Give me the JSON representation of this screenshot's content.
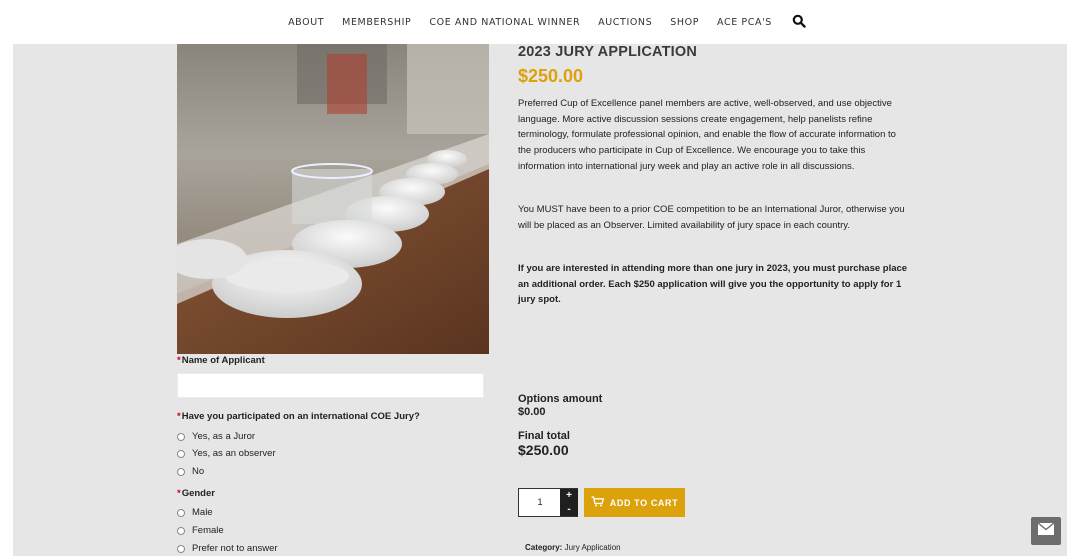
{
  "nav": {
    "items": [
      "ABOUT",
      "MEMBERSHIP",
      "COE AND NATIONAL WINNER",
      "AUCTIONS",
      "SHOP",
      "ACE PCA'S"
    ],
    "search_icon": "search-icon"
  },
  "product": {
    "title": "2023 JURY APPLICATION",
    "price": "$250.00",
    "description_1": "Preferred Cup of Excellence panel members are active, well-observed, and use objective language.  More active discussion sessions create engagement, help panelists refine terminology, formulate professional opinion, and enable the flow of accurate information to the producers who participate in Cup of Excellence.  We encourage you to take this information into international jury week and play an active role in all discussions.",
    "description_2": "You MUST have been to a prior COE competition to be an International Juror, otherwise you will be placed as an Observer. Limited availability of jury space in each country.",
    "description_3": "If you are interested in attending more than one jury in 2023, you must purchase place an additional order. Each $250 application will give you the opportunity to apply for 1 jury spot.",
    "image_icon": "cupping-table-photo"
  },
  "form": {
    "required_mark": "*",
    "name_label": "Name of Applicant",
    "name_value": "",
    "jury_question": "Have you participated on an international COE Jury?",
    "jury_options": [
      "Yes, as a Juror",
      "Yes, as an observer",
      "No"
    ],
    "gender_label": "Gender",
    "gender_options": [
      "Male",
      "Female",
      "Prefer not to answer"
    ]
  },
  "totals": {
    "options_label": "Options amount",
    "options_value": "$0.00",
    "final_label": "Final total",
    "final_value": "$250.00"
  },
  "cart": {
    "quantity": "1",
    "plus": "+",
    "minus": "-",
    "button_label": "ADD TO CART",
    "cart_icon": "cart-icon"
  },
  "meta": {
    "category_label": "Category:",
    "category_value": "Jury Application"
  },
  "floating": {
    "icon": "envelope-icon"
  },
  "colors": {
    "accent": "#dba20b",
    "required": "#d0021b",
    "panel_bg": "#e6e6e6"
  }
}
